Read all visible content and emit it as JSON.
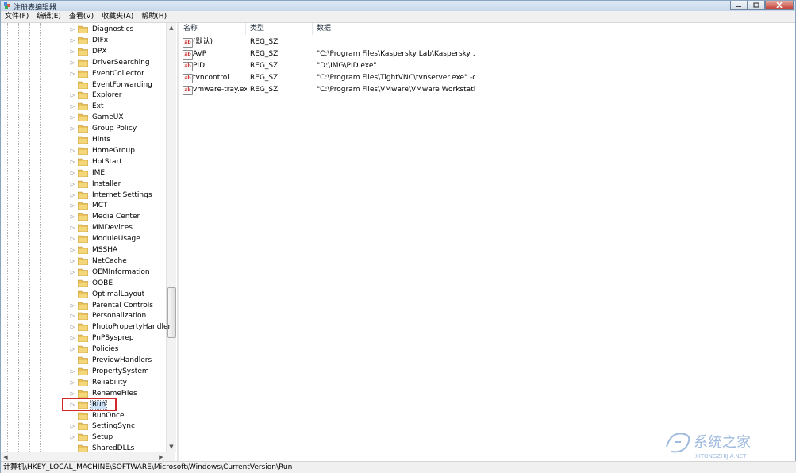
{
  "window": {
    "title": "注册表编辑器",
    "controls": [
      "minimize",
      "maximize",
      "close"
    ]
  },
  "menubar": [
    "文件(F)",
    "编辑(E)",
    "查看(V)",
    "收藏夹(A)",
    "帮助(H)"
  ],
  "tree": {
    "items": [
      {
        "label": "Diagnostics",
        "expandable": true
      },
      {
        "label": "DIFx",
        "expandable": true
      },
      {
        "label": "DPX",
        "expandable": true
      },
      {
        "label": "DriverSearching",
        "expandable": true
      },
      {
        "label": "EventCollector",
        "expandable": true
      },
      {
        "label": "EventForwarding",
        "expandable": false
      },
      {
        "label": "Explorer",
        "expandable": true
      },
      {
        "label": "Ext",
        "expandable": true
      },
      {
        "label": "GameUX",
        "expandable": true
      },
      {
        "label": "Group Policy",
        "expandable": true
      },
      {
        "label": "Hints",
        "expandable": false
      },
      {
        "label": "HomeGroup",
        "expandable": true
      },
      {
        "label": "HotStart",
        "expandable": true
      },
      {
        "label": "IME",
        "expandable": true
      },
      {
        "label": "Installer",
        "expandable": true
      },
      {
        "label": "Internet Settings",
        "expandable": true
      },
      {
        "label": "MCT",
        "expandable": true
      },
      {
        "label": "Media Center",
        "expandable": true
      },
      {
        "label": "MMDevices",
        "expandable": true
      },
      {
        "label": "ModuleUsage",
        "expandable": true
      },
      {
        "label": "MSSHA",
        "expandable": true
      },
      {
        "label": "NetCache",
        "expandable": true
      },
      {
        "label": "OEMInformation",
        "expandable": true
      },
      {
        "label": "OOBE",
        "expandable": false
      },
      {
        "label": "OptimalLayout",
        "expandable": false
      },
      {
        "label": "Parental Controls",
        "expandable": true
      },
      {
        "label": "Personalization",
        "expandable": true
      },
      {
        "label": "PhotoPropertyHandler",
        "expandable": true
      },
      {
        "label": "PnPSysprep",
        "expandable": true
      },
      {
        "label": "Policies",
        "expandable": true
      },
      {
        "label": "PreviewHandlers",
        "expandable": false
      },
      {
        "label": "PropertySystem",
        "expandable": true
      },
      {
        "label": "Reliability",
        "expandable": true
      },
      {
        "label": "RenameFiles",
        "expandable": true
      },
      {
        "label": "Run",
        "expandable": true,
        "selected": true
      },
      {
        "label": "RunOnce",
        "expandable": false
      },
      {
        "label": "SettingSync",
        "expandable": true
      },
      {
        "label": "Setup",
        "expandable": true
      },
      {
        "label": "SharedDLLs",
        "expandable": false
      }
    ]
  },
  "values_list": {
    "columns": [
      "名称",
      "类型",
      "数据"
    ],
    "rows": [
      {
        "name": "(默认)",
        "type": "REG_SZ",
        "data": ""
      },
      {
        "name": "AVP",
        "type": "REG_SZ",
        "data": "\"C:\\Program Files\\Kaspersky Lab\\Kaspersky ..."
      },
      {
        "name": "PID",
        "type": "REG_SZ",
        "data": "\"D:\\IMG\\PID.exe\""
      },
      {
        "name": "tvncontrol",
        "type": "REG_SZ",
        "data": "\"C:\\Program Files\\TightVNC\\tvnserver.exe\" -c..."
      },
      {
        "name": "vmware-tray.exe",
        "type": "REG_SZ",
        "data": "\"C:\\Program Files\\VMware\\VMware Workstati..."
      }
    ],
    "value_icon": "ab-string-icon"
  },
  "statusbar": {
    "path": "计算机\\HKEY_LOCAL_MACHINE\\SOFTWARE\\Microsoft\\Windows\\CurrentVersion\\Run"
  },
  "watermark": {
    "text": "系统之家",
    "subtext": "XITONGZHIJIA.NET"
  },
  "colors": {
    "folder": "#e9c25a",
    "highlight_box": "#d0282d",
    "selection": "#cfe4fa"
  }
}
